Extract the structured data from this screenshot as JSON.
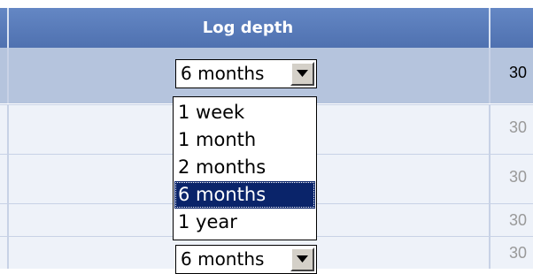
{
  "table": {
    "column_header": "Log depth",
    "rows": [
      {
        "selected_value": "6 months",
        "right_value": "30"
      },
      {
        "right_value": "30"
      },
      {
        "right_value": "30"
      },
      {
        "right_value": "30"
      },
      {
        "selected_value": "6 months",
        "right_value": "30"
      }
    ]
  },
  "dropdown": {
    "options": [
      "1 week",
      "1 month",
      "2 months",
      "6 months",
      "1 year"
    ],
    "selected_index": 3
  },
  "icons": {
    "arrow": "chevron-down-icon"
  }
}
